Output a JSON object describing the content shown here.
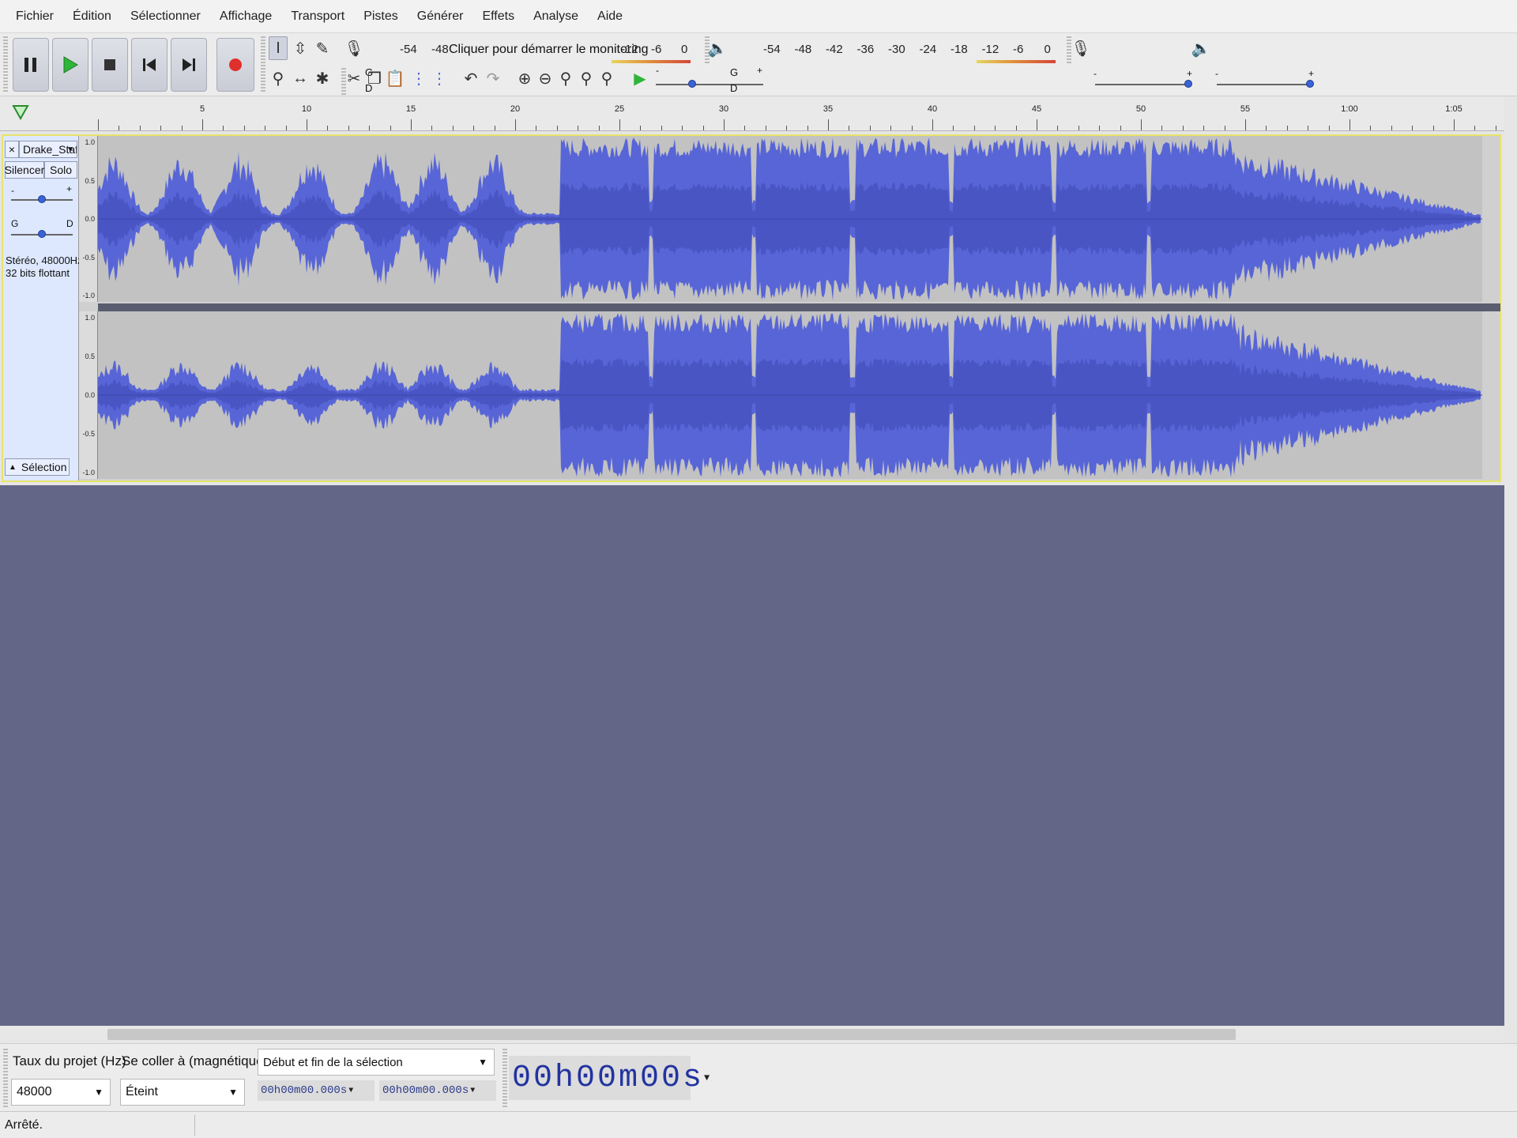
{
  "menu": [
    "Fichier",
    "Édition",
    "Sélectionner",
    "Affichage",
    "Transport",
    "Pistes",
    "Générer",
    "Effets",
    "Analyse",
    "Aide"
  ],
  "record_meter": {
    "scale": [
      "-54",
      "-48",
      "-12",
      "-6",
      "0"
    ],
    "channels": [
      "G",
      "D"
    ],
    "monitor_hint": "Cliquer pour démarrer le monitoring"
  },
  "play_meter": {
    "scale": [
      "-54",
      "-48",
      "-42",
      "-36",
      "-30",
      "-24",
      "-18",
      "-12",
      "-6",
      "0"
    ],
    "channels": [
      "G",
      "D"
    ]
  },
  "mixer": {
    "minus": "-",
    "plus": "+"
  },
  "timeline": {
    "labels": [
      "5",
      "10",
      "15",
      "20",
      "25",
      "30",
      "35",
      "40",
      "45",
      "50",
      "55",
      "1:00",
      "1:05"
    ]
  },
  "track": {
    "name": "Drake_Staff",
    "close": "×",
    "mute": "Silencer",
    "solo": "Solo",
    "gain_minus": "-",
    "gain_plus": "+",
    "pan_left": "G",
    "pan_right": "D",
    "info_line1": "Stéréo, 48000Hz",
    "info_line2": "32 bits flottant",
    "select": "Sélection",
    "ruler": [
      "1.0",
      "0.5",
      "0.0",
      "-0.5",
      "-1.0"
    ],
    "waveform_color": "#5865d6"
  },
  "selection_toolbar": {
    "rate_label": "Taux du projet (Hz)",
    "rate_value": "48000",
    "snap_label": "Se coller à (magnétique)",
    "snap_value": "Éteint",
    "mode_value": "Début et fin de la sélection",
    "start_time": "00h00m00.000s",
    "end_time": "00h00m00.000s",
    "position": "00h00m00s"
  },
  "status": {
    "text": "Arrêté."
  }
}
